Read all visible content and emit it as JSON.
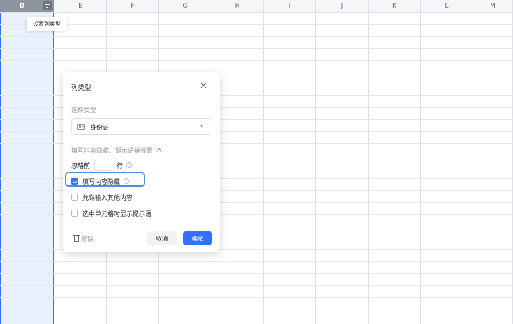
{
  "columns": [
    {
      "id": "D",
      "label": "D",
      "selected": true
    },
    {
      "id": "E",
      "label": "E",
      "selected": false
    },
    {
      "id": "F",
      "label": "F",
      "selected": false
    },
    {
      "id": "G",
      "label": "G",
      "selected": false
    },
    {
      "id": "H",
      "label": "H",
      "selected": false
    },
    {
      "id": "I",
      "label": "I",
      "selected": false
    },
    {
      "id": "J",
      "label": "J",
      "selected": false
    },
    {
      "id": "K",
      "label": "K",
      "selected": false
    },
    {
      "id": "L",
      "label": "L",
      "selected": false
    },
    {
      "id": "M",
      "label": "M",
      "selected": false
    }
  ],
  "tooltip": {
    "text": "设置列类型"
  },
  "dialog": {
    "title": "列类型",
    "select_type_label": "选择类型",
    "selected_type": "身份证",
    "settings_header": "填写内容隐藏、提示语等设置",
    "ignore_prefix": "忽略前",
    "ignore_suffix": "行",
    "ignore_value": "",
    "options": [
      {
        "label": "填写内容隐藏",
        "checked": true,
        "help": true
      },
      {
        "label": "允许输入其他内容",
        "checked": false,
        "help": false
      },
      {
        "label": "选中单元格时显示提示语",
        "checked": false,
        "help": false
      }
    ],
    "remove_label": "移除",
    "cancel_label": "取消",
    "confirm_label": "确定"
  },
  "colors": {
    "accent": "#3370ff",
    "selected_column": "#e8f1fc",
    "header_selected": "#8f959e"
  },
  "icons": [
    "column-menu-icon",
    "close-icon",
    "id-card-icon",
    "caret-down-icon",
    "chevron-up-icon",
    "help-icon",
    "checkbox-icon",
    "trash-icon"
  ]
}
